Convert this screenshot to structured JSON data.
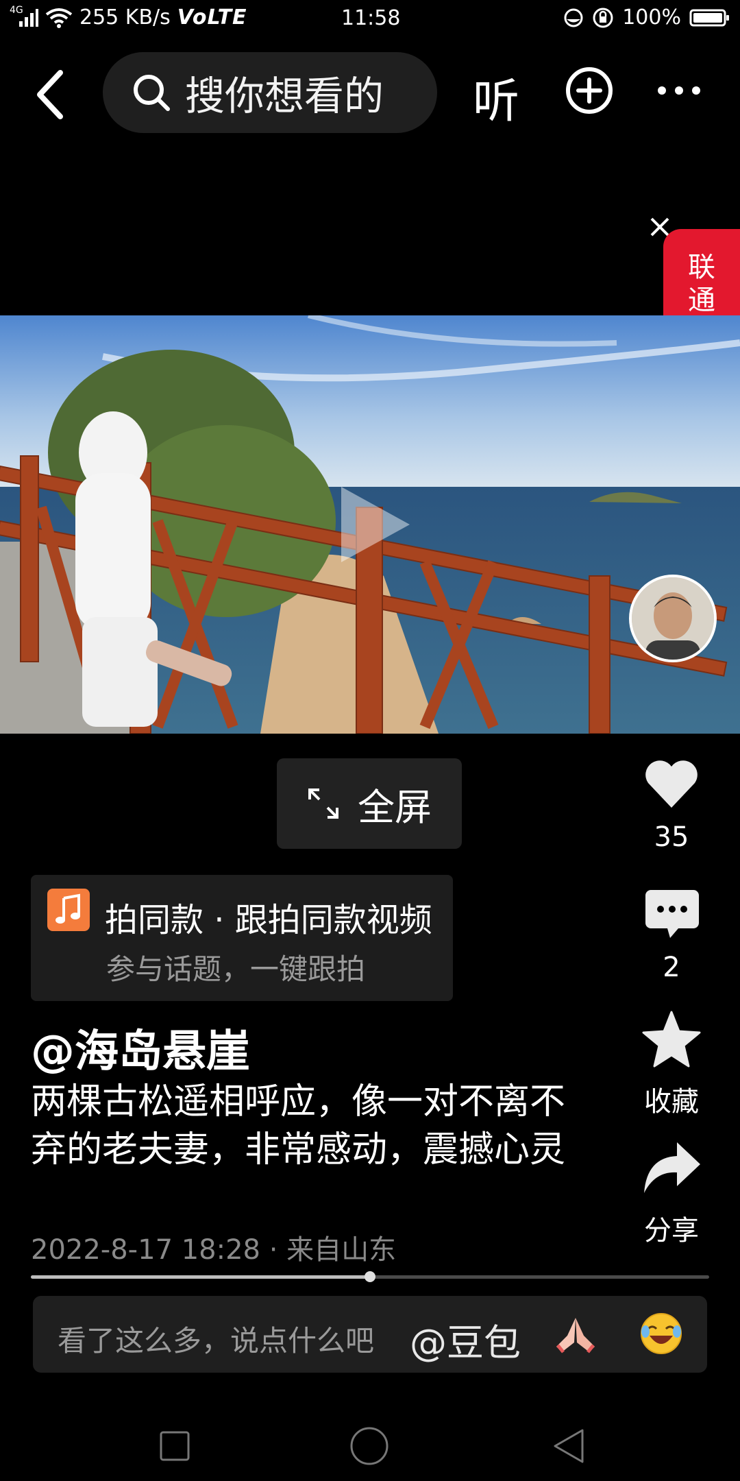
{
  "status_bar": {
    "network": "4G",
    "speed": "255 KB/s",
    "volte": "VoLTE",
    "time": "11:58",
    "battery": "100%"
  },
  "top_nav": {
    "search_placeholder": "搜你想看的",
    "listen_label": "听",
    "icons": [
      "back-arrow-icon",
      "search-icon",
      "add-circle-icon",
      "more-icon"
    ]
  },
  "ad": {
    "text": "联通魔方",
    "close_icon": "close-icon"
  },
  "video": {
    "fullscreen_label": "全屏",
    "play_icon": "play-icon"
  },
  "actions": {
    "like_count": "35",
    "comment_count": "2",
    "favorite_label": "收藏",
    "share_label": "分享"
  },
  "music": {
    "title": "拍同款 · 跟拍同款视频",
    "subtitle": "参与话题，一键跟拍"
  },
  "post": {
    "author": "@海岛悬崖",
    "description": "两棵古松遥相呼应，像一对不离不弃的老夫妻，非常感动，震撼心灵",
    "meta": "2022-8-17 18:28 · 来自山东",
    "progress": 0.5
  },
  "comment_bar": {
    "placeholder": "看了这么多，说点什么吧",
    "mention": "@豆包"
  },
  "colors": {
    "background": "#000000",
    "ad_red": "#e3182e",
    "card_bg": "#1d1d1d",
    "music_orange": "#f47c3c"
  }
}
